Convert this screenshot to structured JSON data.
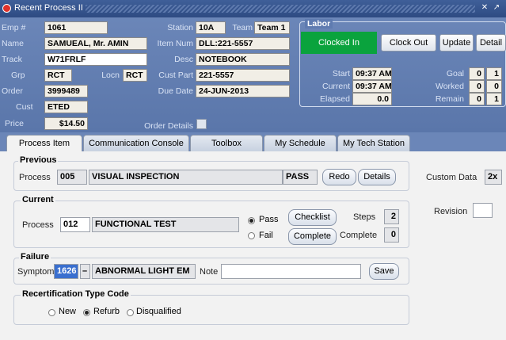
{
  "window": {
    "title": "Recent Process II"
  },
  "header": {
    "emp_label": "Emp #",
    "emp": "1061",
    "name_label": "Name",
    "name": "SAMUEAL, Mr. AMIN",
    "track_label": "Track",
    "track": "W71FRLF",
    "grp_label": "Grp",
    "grp": "RCT",
    "locn_label": "Locn",
    "locn": "RCT",
    "order_label": "Order",
    "order": "3999489",
    "cust_label": "Cust",
    "cust": "ETED",
    "price_label": "Price",
    "price": "$14.50",
    "station_label": "Station",
    "station": "10A",
    "team_label": "Team",
    "team": "Team 1",
    "item_num_label": "Item Num",
    "item_num": "DLL:221-5557",
    "desc_label": "Desc",
    "desc": "NOTEBOOK",
    "cust_part_label": "Cust Part",
    "cust_part": "221-5557",
    "due_date_label": "Due Date",
    "due_date": "24-JUN-2013",
    "order_details_label": "Order Details"
  },
  "labor": {
    "title": "Labor",
    "status": "Clocked In",
    "clock_out": "Clock Out",
    "update": "Update",
    "detail": "Detail",
    "start_label": "Start",
    "start": "09:37 AM",
    "current_label": "Current",
    "current": "09:37 AM",
    "elapsed_label": "Elapsed",
    "elapsed": "0.0",
    "goal_label": "Goal",
    "goal_a": "0",
    "goal_b": "1",
    "worked_label": "Worked",
    "worked_a": "0",
    "worked_b": "0",
    "remain_label": "Remain",
    "remain_a": "0",
    "remain_b": "1"
  },
  "tabs": [
    {
      "label": "Process Item"
    },
    {
      "label": "Communication Console"
    },
    {
      "label": "Toolbox"
    },
    {
      "label": "My Schedule"
    },
    {
      "label": "My Tech Station"
    }
  ],
  "previous": {
    "title": "Previous",
    "process_label": "Process",
    "process_code": "005",
    "process_name": "VISUAL INSPECTION",
    "result": "PASS",
    "redo": "Redo",
    "details": "Details"
  },
  "custom_data": {
    "label": "Custom Data",
    "value": "2x"
  },
  "revision": {
    "label": "Revision",
    "value": ""
  },
  "current": {
    "title": "Current",
    "process_label": "Process",
    "process_code": "012",
    "process_name": "FUNCTIONAL TEST",
    "pass_label": "Pass",
    "fail_label": "Fail",
    "checklist": "Checklist",
    "complete_btn": "Complete",
    "steps_label": "Steps",
    "steps": "2",
    "complete_label": "Complete",
    "complete": "0",
    "selected": "Pass"
  },
  "failure": {
    "title": "Failure",
    "symptom_label": "Symptom",
    "symptom_code": "1626",
    "dash": "–",
    "symptom_desc": "ABNORMAL LIGHT EM",
    "note_label": "Note",
    "note": "",
    "save": "Save"
  },
  "recert": {
    "title": "Recertification Type Code",
    "options": [
      "New",
      "Refurb",
      "Disqualified"
    ],
    "selected": "Refurb"
  },
  "colors": {
    "header_bg": "#6b86b8",
    "clocked_in": "#0aa33d",
    "title_bar": "#2e4b82"
  }
}
